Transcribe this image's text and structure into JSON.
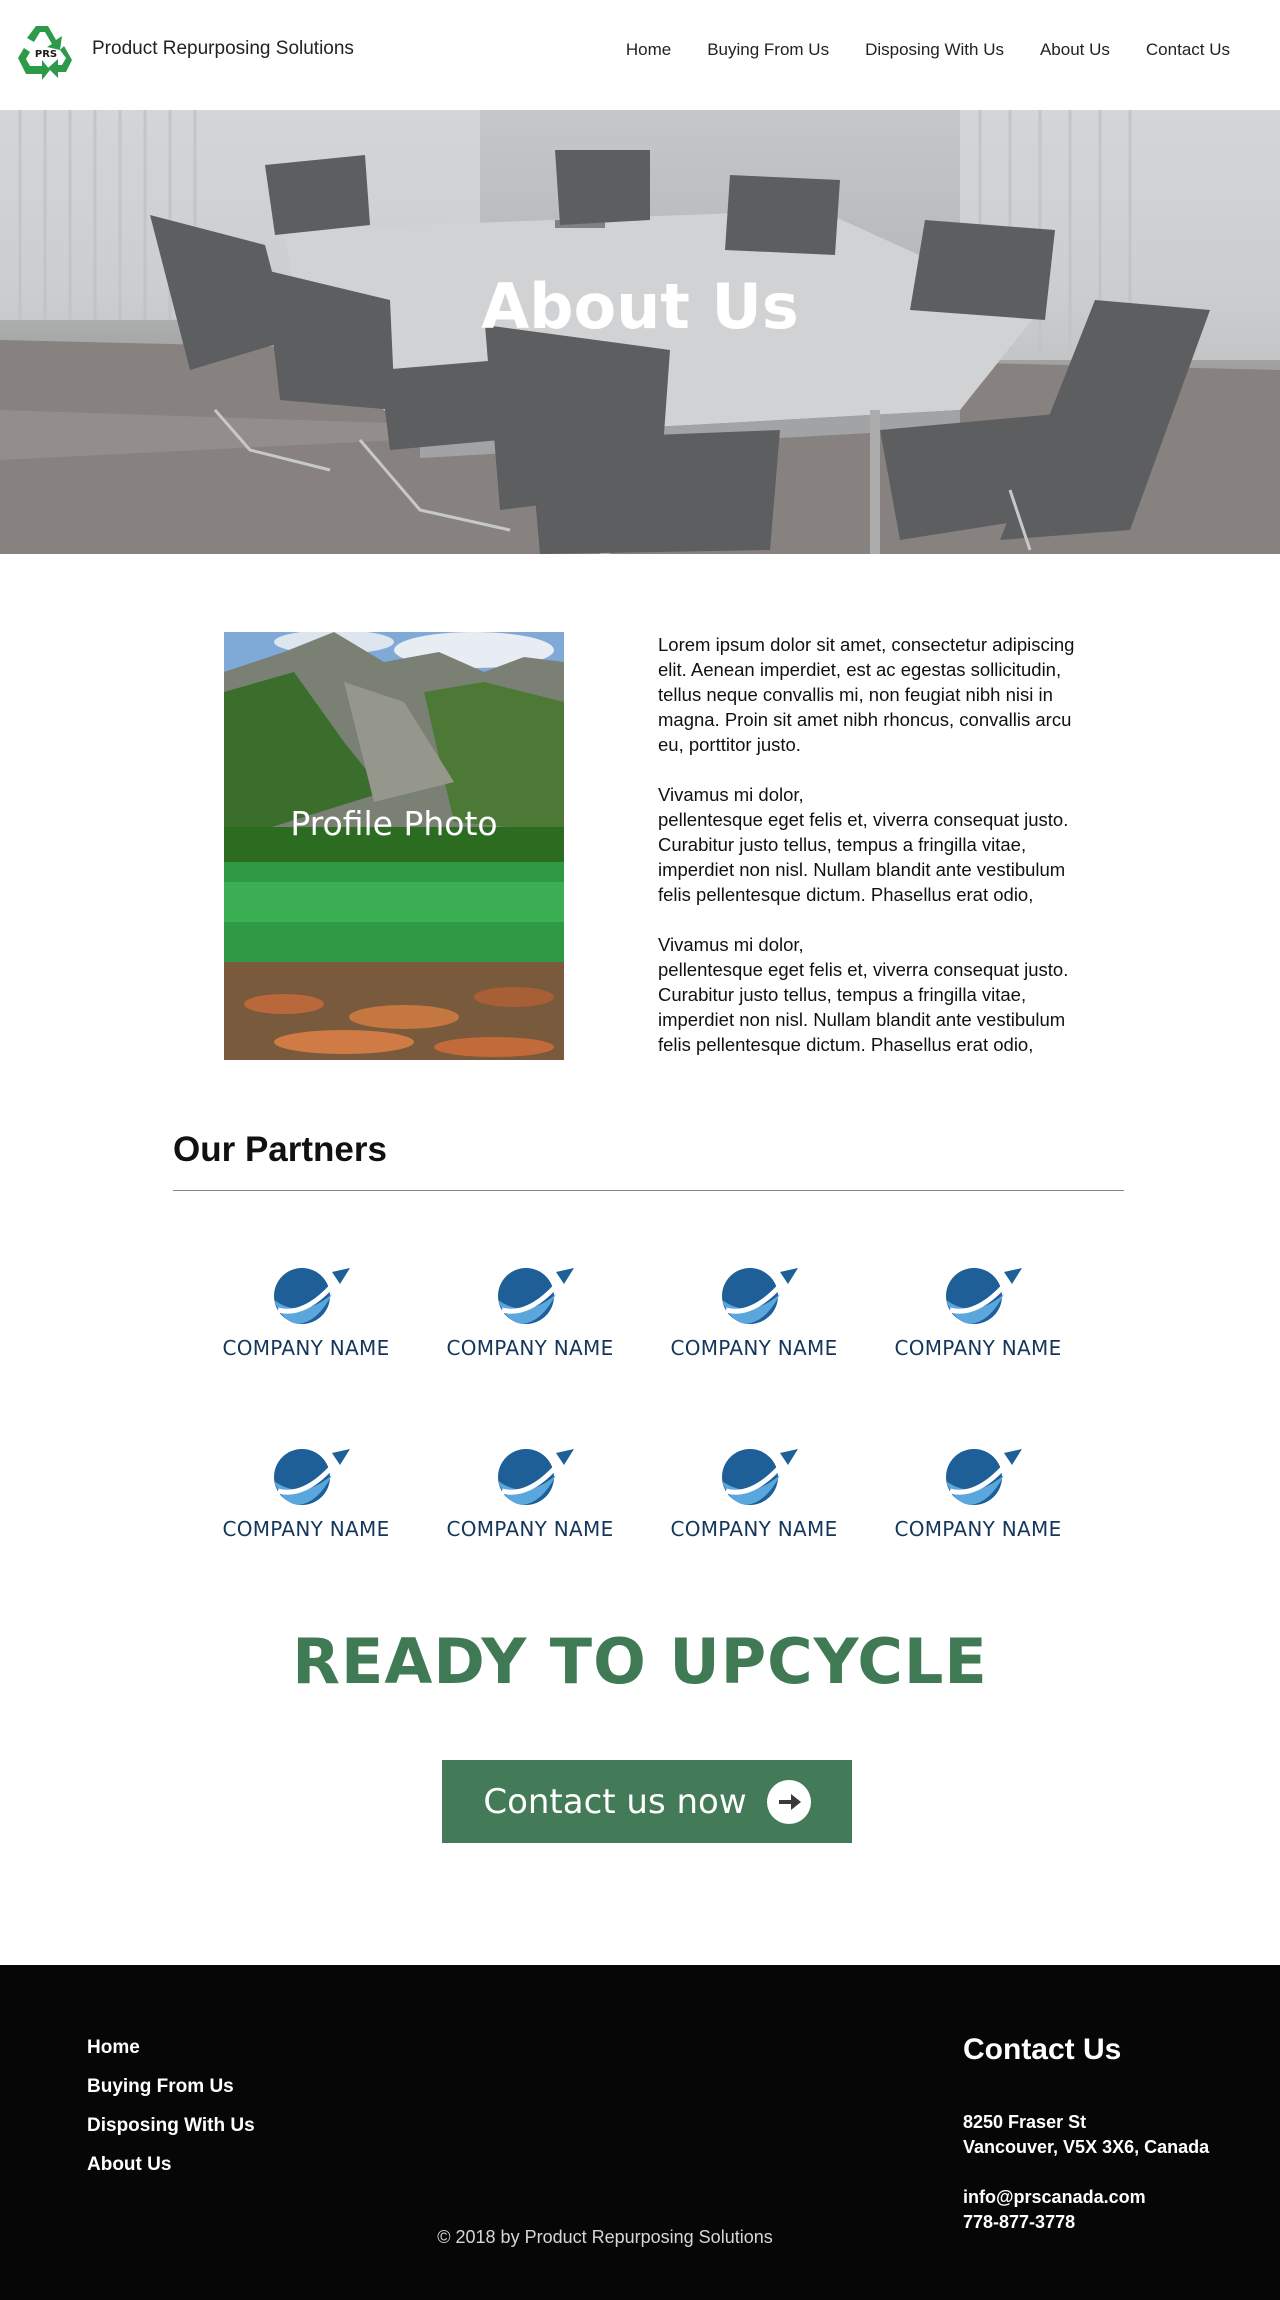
{
  "header": {
    "logo_text": "PRS",
    "brand": "Product Repurposing Solutions",
    "nav": [
      "Home",
      "Buying From Us",
      "Disposing With Us",
      "About Us",
      "Contact Us"
    ]
  },
  "hero": {
    "title": "About Us"
  },
  "about": {
    "profile_label": "Profile Photo",
    "paragraph_1": "Lorem ipsum dolor sit amet, consectetur adipiscing elit. Aenean imperdiet, est ac egestas sollicitudin, tellus neque convallis mi, non feugiat  nibh nisi in magna. Proin sit amet nibh rhoncus, convallis arcu eu, porttitor justo.",
    "paragraph_2_line1": "Vivamus mi dolor,",
    "paragraph_2_rest": "pellentesque eget felis et, viverra consequat justo. Curabitur justo tellus, tempus a fringilla vitae, imperdiet non nisl. Nullam blandit ante vestibulum felis pellentesque dictum. Phasellus erat odio,",
    "paragraph_3_line1": "Vivamus mi dolor,",
    "paragraph_3_rest": "pellentesque eget felis et, viverra consequat justo. Curabitur justo tellus, tempus a fringilla vitae, imperdiet non nisl. Nullam blandit ante vestibulum felis pellentesque dictum. Phasellus erat odio,"
  },
  "partners": {
    "title": "Our Partners",
    "items": [
      "COMPANY NAME",
      "COMPANY NAME",
      "COMPANY NAME",
      "COMPANY NAME",
      "COMPANY NAME",
      "COMPANY NAME",
      "COMPANY NAME",
      "COMPANY NAME"
    ]
  },
  "cta": {
    "title": "READY TO UPCYCLE",
    "button_label": "Contact us now"
  },
  "footer": {
    "nav": [
      "Home",
      "Buying From Us",
      "Disposing With Us",
      "About Us"
    ],
    "contact_title": "Contact Us",
    "address_line1": "8250 Fraser St",
    "address_line2": "Vancouver, V5X 3X6, Canada",
    "email": "info@prscanada.com",
    "phone": "778-877-3778",
    "copyright": "© 2018  by Product Repurposing Solutions"
  },
  "colors": {
    "logo_green": "#2c9a48",
    "accent_green": "#437a57",
    "cta_title": "#3f7a55",
    "partner_blue": "#16375c",
    "footer_bg": "#060606"
  },
  "icons": [
    "recycle-logo-icon",
    "globe-plane-logo-icon",
    "arrow-right-circle-icon"
  ]
}
